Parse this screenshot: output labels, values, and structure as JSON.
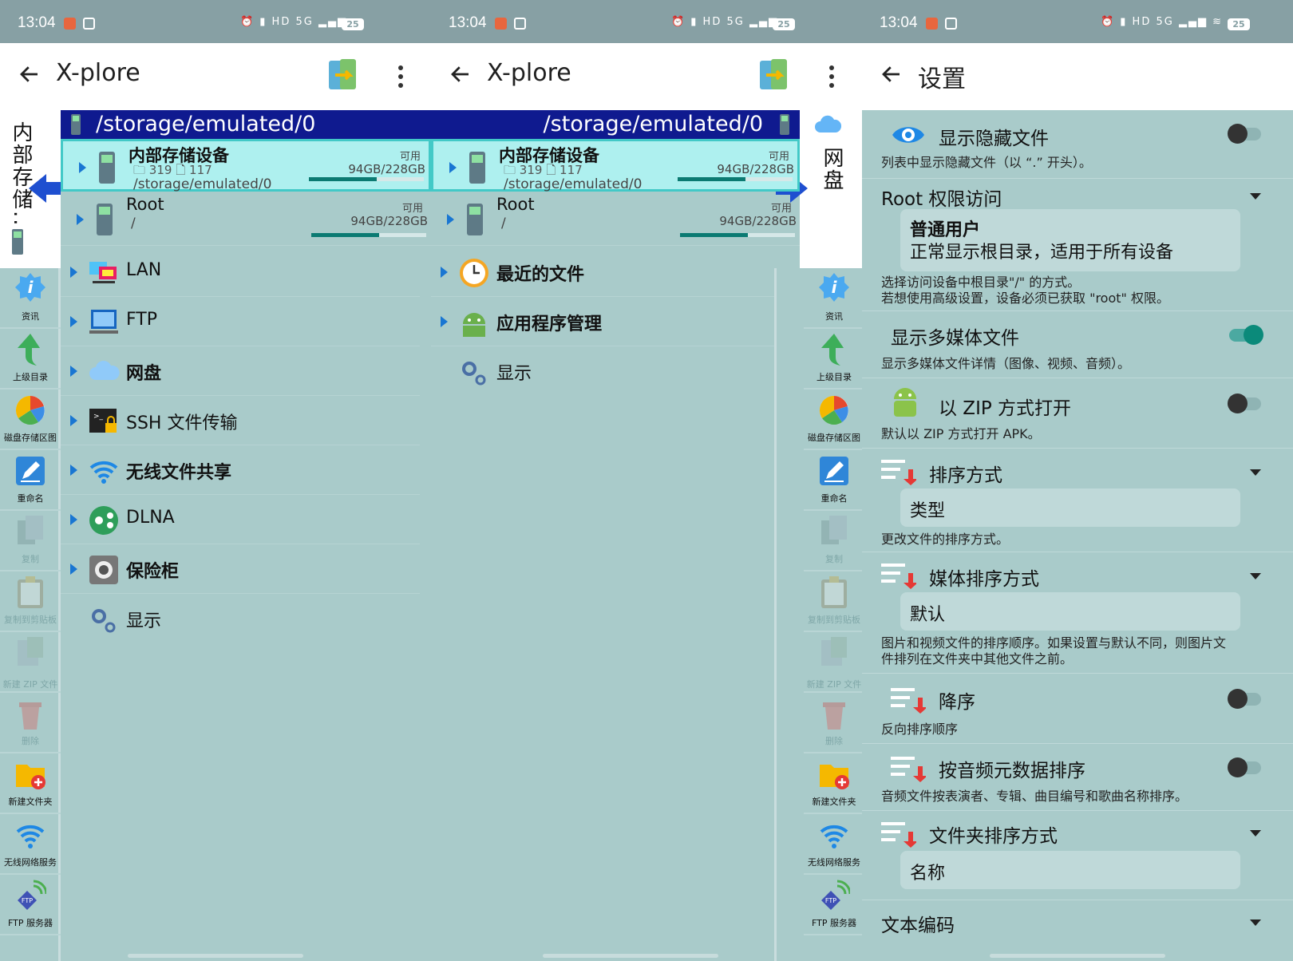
{
  "status": {
    "time": "13:04",
    "battery": "25",
    "signal": "5G"
  },
  "panel1": {
    "app_title": "X-plore",
    "vertical_tab": "内部存储...",
    "path": "/storage/emulated/0",
    "storages": [
      {
        "name": "内部存储设备",
        "folders": "319",
        "files": "117",
        "path": "/storage/emulated/0",
        "avail_label": "可用",
        "size": "94GB/228GB",
        "used_fraction": 0.59
      },
      {
        "name": "Root",
        "path": "/",
        "avail_label": "可用",
        "size": "94GB/228GB",
        "used_fraction": 0.59
      }
    ],
    "items": [
      "LAN",
      "FTP",
      "网盘",
      "SSH 文件传输",
      "无线文件共享",
      "DLNA",
      "保险柜",
      "显示"
    ]
  },
  "panel2": {
    "app_title": "X-plore",
    "vertical_tab": "网盘",
    "path": "/storage/emulated/0",
    "storages": [
      {
        "name": "内部存储设备",
        "folders": "319",
        "files": "117",
        "path": "/storage/emulated/0",
        "avail_label": "可用",
        "size": "94GB/228GB",
        "used_fraction": 0.59
      },
      {
        "name": "Root",
        "path": "/",
        "avail_label": "可用",
        "size": "94GB/228GB",
        "used_fraction": 0.59
      }
    ],
    "items": [
      "最近的文件",
      "应用程序管理",
      "显示"
    ]
  },
  "toolbar": [
    "资讯",
    "上级目录",
    "磁盘存储区图",
    "重命名",
    "复制",
    "复制到剪贴板",
    "新建 ZIP 文件",
    "删除",
    "新建文件夹",
    "无线网络服务",
    "FTP 服务器"
  ],
  "settings": {
    "title": "设置",
    "show_hidden": {
      "title": "显示隐藏文件",
      "desc": "列表中显示隐藏文件（以 “.” 开头）。",
      "on": false
    },
    "root_access": {
      "title": "Root 权限访问",
      "value_title": "普通用户",
      "value_desc": "正常显示根目录，适用于所有设备",
      "desc1": "选择访问设备中根目录\"/\" 的方式。",
      "desc2": "若想使用高级设置，设备必须已获取 \"root\" 权限。"
    },
    "show_media": {
      "title": "显示多媒体文件",
      "desc": "显示多媒体文件详情（图像、视频、音频）。",
      "on": true
    },
    "zip_open": {
      "title": "以 ZIP 方式打开",
      "desc": "默认以 ZIP 方式打开 APK。",
      "on": false
    },
    "sort": {
      "title": "排序方式",
      "value": "类型",
      "desc": "更改文件的排序方式。"
    },
    "media_sort": {
      "title": "媒体排序方式",
      "value": "默认",
      "desc1": "图片和视频文件的排序顺序。如果设置与默认不同，则图片文",
      "desc2": "件排列在文件夹中其他文件之前。"
    },
    "descending": {
      "title": "降序",
      "desc": "反向排序顺序",
      "on": false
    },
    "audio_meta": {
      "title": "按音频元数据排序",
      "desc": "音频文件按表演者、专辑、曲目编号和歌曲名称排序。",
      "on": false
    },
    "folder_sort": {
      "title": "文件夹排序方式",
      "value": "名称"
    },
    "encoding": {
      "title": "文本编码"
    }
  },
  "colors": {
    "path_bar": "#0f1a8f",
    "panel_bg": "#a9cbca",
    "selected": "#aef0ef",
    "accent": "#0b8a7a"
  }
}
